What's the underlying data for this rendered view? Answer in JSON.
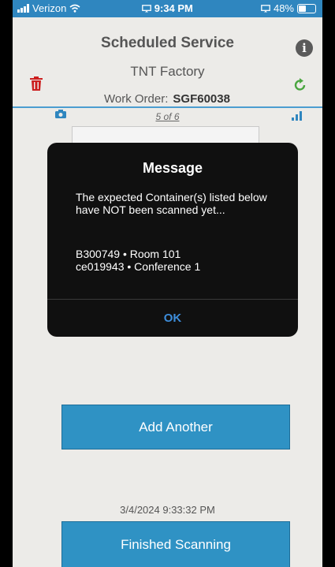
{
  "status_bar": {
    "carrier": "Verizon",
    "time": "9:34 PM",
    "battery": "48%"
  },
  "header": {
    "title": "Scheduled Service",
    "subtitle": "TNT Factory",
    "work_order_label": "Work Order:",
    "work_order_value": "SGF60038",
    "pager": "5 of 6"
  },
  "dialog": {
    "title": "Message",
    "message": "The expected Container(s) listed below have NOT been scanned yet...",
    "containers": [
      "B300749 • Room 101",
      "ce019943 • Conference 1"
    ],
    "ok_label": "OK"
  },
  "actions": {
    "add_another_label": "Add Another",
    "timestamp": "3/4/2024 9:33:32 PM",
    "finished_label": "Finished Scanning"
  },
  "colors": {
    "accent": "#2f92c4",
    "dialog_bg": "#101010",
    "ok_text": "#3d8ddb"
  }
}
